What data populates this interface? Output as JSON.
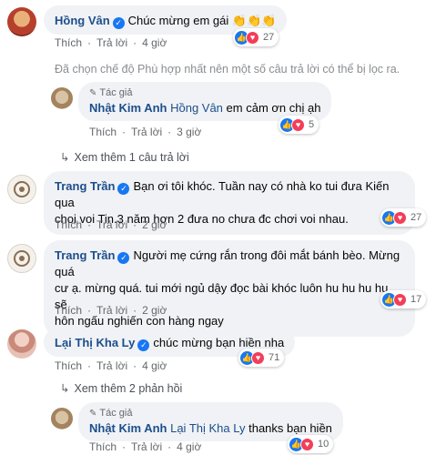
{
  "c1": {
    "name": "Hồng Vân",
    "text": "Chúc mừng em gái",
    "emoji": "👏👏👏",
    "like": "Thích",
    "reply": "Trả lời",
    "time": "4 giờ",
    "reactions": "27"
  },
  "filter_note": "Đã chọn chế độ Phù hợp nhất nên một số câu trả lời có thể bị lọc ra.",
  "r1": {
    "author_tag": "Tác giả",
    "name": "Nhật Kim Anh",
    "mention": "Hồng Vân",
    "text": "em cảm ơn chị ạh",
    "like": "Thích",
    "reply": "Trả lời",
    "time": "3 giờ",
    "reactions": "5"
  },
  "more1": "Xem thêm 1 câu trả lời",
  "c2": {
    "name": "Trang Trần",
    "line1": "Bạn ơi tôi khóc. Tuần nay có nhà ko tui đưa Kiến qua",
    "line2": "choi voi Tin.3 năm hơn 2 đưa no chưa đc chơi voi nhau.",
    "like": "Thích",
    "reply": "Trả lời",
    "time": "2 giờ",
    "reactions": "27"
  },
  "c3": {
    "name": "Trang Trần",
    "line1": "Người mẹ cứng rắn trong đôi mắt bánh bèo. Mừng quá",
    "line2": "cư ạ. mừng quá. tui mới ngủ dậy đọc bài khóc luôn hu hu hu hu. sẽ",
    "line3": "hôn ngấu nghiến con hàng ngay",
    "like": "Thích",
    "reply": "Trả lời",
    "time": "2 giờ",
    "reactions": "17"
  },
  "c4": {
    "name": "Lại Thị Kha Ly",
    "text": "chúc mừng bạn hiền nha",
    "like": "Thích",
    "reply": "Trả lời",
    "time": "4 giờ",
    "reactions": "71"
  },
  "more2": "Xem thêm 2 phản hồi",
  "r2": {
    "author_tag": "Tác giả",
    "name": "Nhật Kim Anh",
    "mention": "Lại Thị Kha Ly",
    "text": "thanks bạn hiền",
    "like": "Thích",
    "reply": "Trả lời",
    "time": "4 giờ",
    "reactions": "10"
  },
  "icons": {
    "verified": "verified-check-icon",
    "like": "like-icon",
    "love": "love-icon",
    "reply_arrow": "reply-arrow-icon",
    "author_pen": "pen-icon"
  },
  "colors": {
    "name": "#1c4e8c",
    "bubble": "#f0f2f5",
    "like": "#1877f2",
    "love": "#f33e58",
    "meta": "#65676b"
  }
}
